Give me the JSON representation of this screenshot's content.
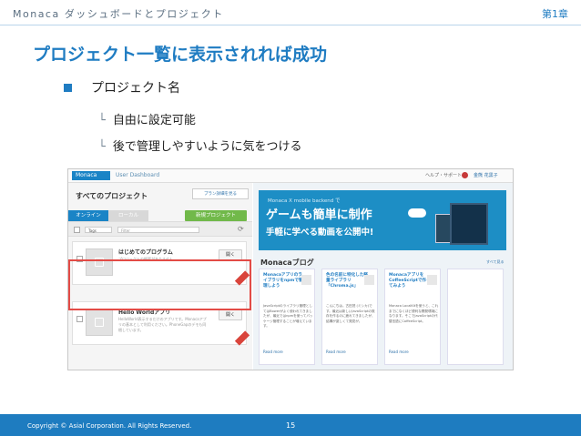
{
  "header": {
    "title": "Monaca ダッシュボードとプロジェクト",
    "chapter": "第1章"
  },
  "slide": {
    "title": "プロジェクト一覧に表示されれば成功",
    "bullet": "プロジェクト名",
    "sub_bullets": [
      "自由に設定可能",
      "後で管理しやすいように気をつける"
    ],
    "sub_marker": "└"
  },
  "screenshot": {
    "topbar": {
      "logo": "Monaca",
      "breadcrumb": "User Dashboard",
      "help": "ヘルプ・サポート",
      "user": "金熊 花黒子"
    },
    "left": {
      "title": "すべてのプロジェクト",
      "plan_button": "プラン詳細を見る",
      "tabs": [
        "オンライン",
        "ローカル"
      ],
      "new_project": "新規プロジェクト",
      "tags_placeholder": "Tags",
      "filter_placeholder": "Filter",
      "projects": [
        {
          "name": "はじめてのプログラム",
          "desc": "プロジェクトの概要がありません。",
          "open": "開く"
        },
        {
          "name": "Hello Worldアプリ",
          "desc": "HelloWorld表示するだけのアプリです。Monacaアプリの基本として利用ください。PhoneGapのデモも同梱しています。",
          "open": "開く"
        }
      ]
    },
    "right": {
      "banner_small": "Monaca X mobile backend で",
      "banner_big": "ゲームも簡単に制作",
      "banner_mid": "手軽に学べる動画を公開中!",
      "blog_title": "Monacaブログ",
      "blog_more": "すべて見る",
      "posts": [
        {
          "title": "Monacaアプリのライブラリをnpmで管理しよう",
          "desc": "JavaScriptのライブラリ管理としてはBowerがよく使われてきましたが、最近ではnpmを使ってパッケージ管理することが増えています。",
          "more": "Read more"
        },
        {
          "title": "色の名前に特化した軽量ライブラリ「Chroma.js」",
          "desc": "こんにちは。古田茂 (ミシカ)です。最近は新しいJavaScriptの既存を作るのに疲れてきましたが、結構が激しくて発見が。",
          "more": "Read more"
        },
        {
          "title": "MonacaアプリをCoffeeScriptで作ってみよう",
          "desc": "Monaca LocalKitを使うと、これまでになくほど便利な開発環境になります。そこでJavaScriptの代替言語にCoffeeScript。",
          "more": "Read more"
        },
        {
          "title": "",
          "desc": "",
          "more": ""
        }
      ]
    }
  },
  "footer": {
    "copyright": "Copyright © Asial Corporation. All Rights Reserved.",
    "page": "15"
  }
}
